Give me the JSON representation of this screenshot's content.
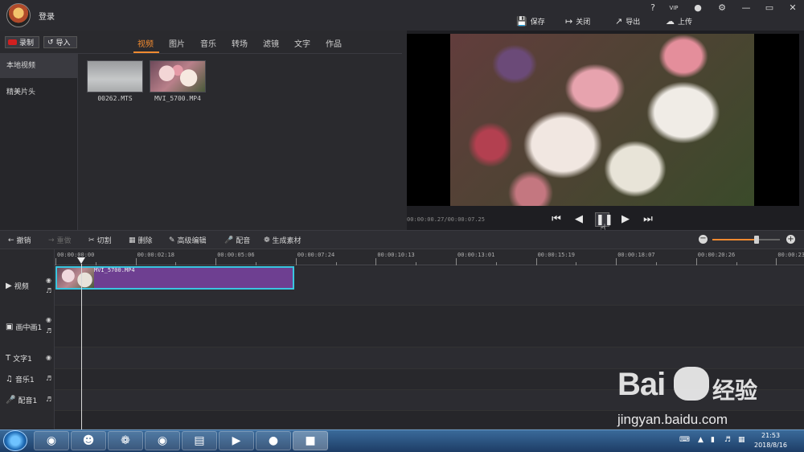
{
  "topbar": {
    "login": "登录",
    "icons": {
      "help": "?",
      "vip": "VIP",
      "bell": "bell-icon",
      "gear": "gear-icon",
      "minimize": "—",
      "restore": "▭",
      "close": "✕"
    },
    "actions": [
      {
        "label": "保存",
        "icon": "save-icon"
      },
      {
        "label": "关闭",
        "icon": "exit-icon"
      },
      {
        "label": "导出",
        "icon": "export-icon"
      },
      {
        "label": "上传",
        "icon": "upload-icon"
      }
    ]
  },
  "media": {
    "record_label": "录制",
    "import_label": "导入",
    "tabs": [
      "视频",
      "图片",
      "音乐",
      "转场",
      "滤镜",
      "文字",
      "作品"
    ],
    "active_tab": "视频",
    "sidebar": [
      "本地视频",
      "精美片头"
    ],
    "files": [
      {
        "name": "00262.MTS"
      },
      {
        "name": "MVI_5700.MP4"
      }
    ]
  },
  "preview": {
    "timecode": "00:00:00.27/00:00:07.25"
  },
  "toolbar": {
    "tools": [
      {
        "label": "撤销",
        "icon": "undo-icon",
        "enabled": true
      },
      {
        "label": "重做",
        "icon": "redo-icon",
        "enabled": false
      },
      {
        "label": "切割",
        "icon": "scissors-icon",
        "enabled": true
      },
      {
        "label": "删除",
        "icon": "trash-icon",
        "enabled": true
      },
      {
        "label": "高级编辑",
        "icon": "pencil-icon",
        "enabled": true
      },
      {
        "label": "配音",
        "icon": "mic-icon",
        "enabled": true
      },
      {
        "label": "生成素材",
        "icon": "film-reel-icon",
        "enabled": true
      }
    ],
    "zoom_level": 0.65
  },
  "timeline": {
    "ruler": [
      "00:00:00:00",
      "00:00:02:18",
      "00:00:05:06",
      "00:00:07:24",
      "00:00:10:13",
      "00:00:13:01",
      "00:00:15:19",
      "00:00:18:07",
      "00:00:20:26",
      "00:00:23:"
    ],
    "tracks": [
      {
        "label": "视频",
        "icon": "play-icon"
      },
      {
        "label": "画中画1",
        "icon": "pip-icon"
      },
      {
        "label": "文字1",
        "icon": "text-icon"
      },
      {
        "label": "音乐1",
        "icon": "music-icon"
      },
      {
        "label": "配音1",
        "icon": "mic-icon"
      }
    ],
    "clip": {
      "name": "MVI_5700.MP4"
    }
  },
  "taskbar": {
    "time": "21:53",
    "date": "2018/8/16"
  },
  "watermark": {
    "logo": "Bai",
    "logo_cn": "经验",
    "url": "jingyan.baidu.com"
  },
  "colors": {
    "accent": "#f08a30",
    "clip": "#6e3f91",
    "clip_border": "#39c6e0"
  }
}
